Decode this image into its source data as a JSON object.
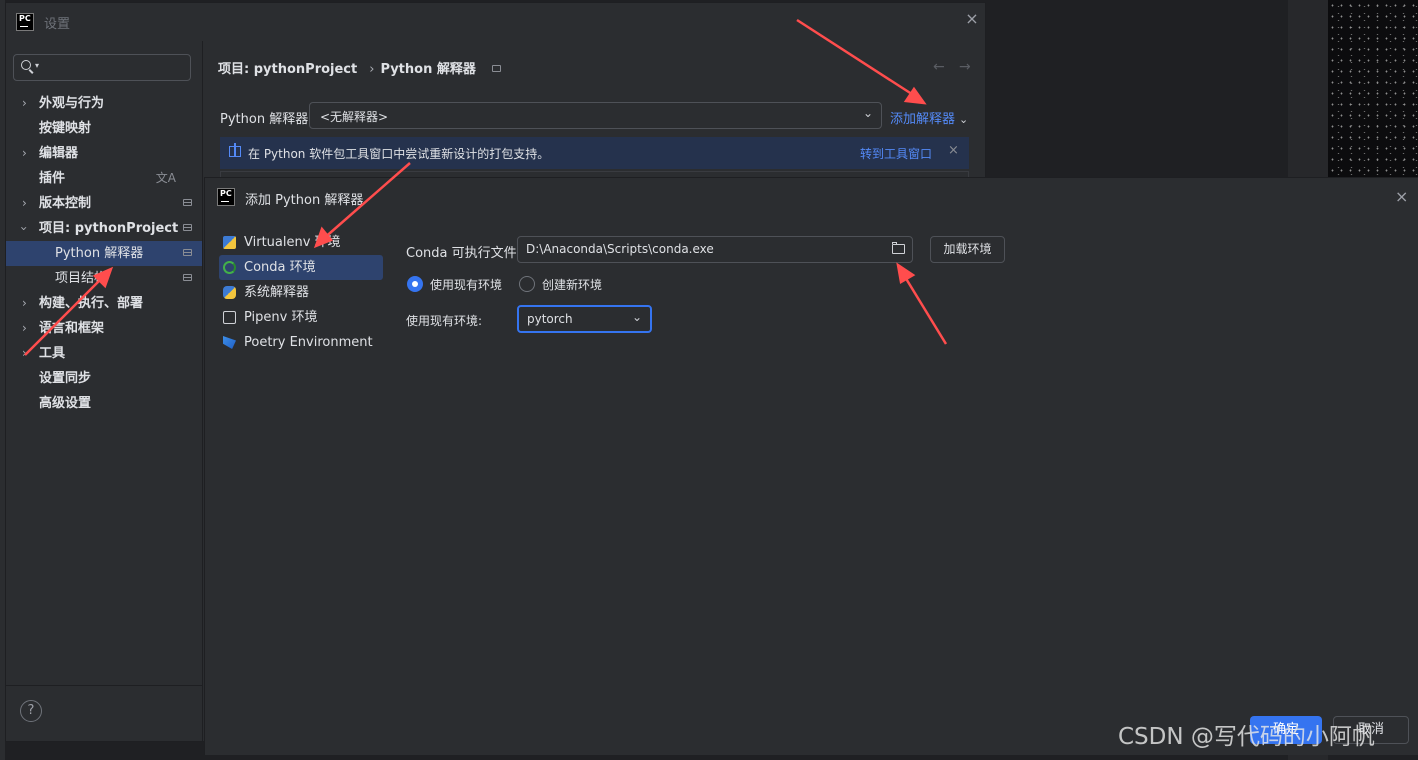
{
  "settings_window": {
    "title": "设置",
    "app_logo": "PC",
    "close_icon": "×",
    "search": {
      "value": "",
      "placeholder": ""
    },
    "tree": [
      {
        "label": "外观与行为",
        "expandable": true
      },
      {
        "label": "按键映射",
        "expandable": false
      },
      {
        "label": "编辑器",
        "expandable": true
      },
      {
        "label": "插件",
        "expandable": false
      },
      {
        "label": "版本控制",
        "expandable": true
      },
      {
        "label": "项目: pythonProject",
        "expandable": true,
        "expanded": true
      },
      {
        "label": "Python 解释器",
        "child": true,
        "selected": true
      },
      {
        "label": "项目结构",
        "child": true
      },
      {
        "label": "构建、执行、部署",
        "expandable": true
      },
      {
        "label": "语言和框架",
        "expandable": true
      },
      {
        "label": "工具",
        "expandable": true
      },
      {
        "label": "设置同步",
        "expandable": false
      },
      {
        "label": "高级设置",
        "expandable": false
      }
    ],
    "help_label": "?",
    "breadcrumb": {
      "project": "项目: pythonProject",
      "page": "Python 解释器"
    },
    "nav": {
      "back": "←",
      "forward": "→"
    },
    "interpreter": {
      "label": "Python 解释器:",
      "value": "<无解释器>",
      "add_label": "添加解释器"
    },
    "banner": {
      "text": "在 Python 软件包工具窗口中尝试重新设计的打包支持。",
      "link": "转到工具窗口",
      "close": "×"
    }
  },
  "add_dialog": {
    "title": "添加 Python 解释器",
    "app_logo": "PC",
    "close_icon": "×",
    "env_types": [
      {
        "label": "Virtualenv 环境",
        "icon": "virtualenv-icon"
      },
      {
        "label": "Conda 环境",
        "icon": "conda-icon",
        "selected": true
      },
      {
        "label": "系统解释器",
        "icon": "python-icon"
      },
      {
        "label": "Pipenv 环境",
        "icon": "pipenv-icon"
      },
      {
        "label": "Poetry Environment",
        "icon": "poetry-icon"
      }
    ],
    "conda_exe_label": "Conda 可执行文件:",
    "conda_exe_value": "D:\\Anaconda\\Scripts\\conda.exe",
    "load_env_label": "加载环境",
    "radio_existing": "使用现有环境",
    "radio_new": "创建新环境",
    "use_env_label": "使用现有环境:",
    "use_env_value": "pytorch",
    "ok_label": "确定",
    "cancel_label": "取消"
  },
  "watermark": "CSDN @写代码的小阿帆",
  "colors": {
    "accent": "#3574f0",
    "link": "#548af7",
    "arrow": "#ff4d4d"
  }
}
